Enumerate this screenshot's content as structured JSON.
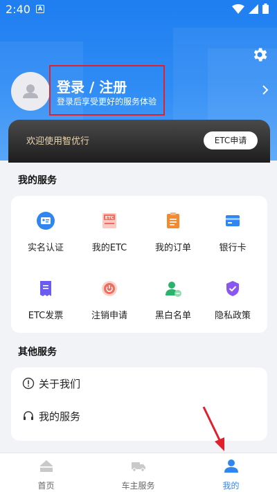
{
  "status_bar": {
    "time": "2:40",
    "notification_letter": "A"
  },
  "profile": {
    "login_title": "登录 / 注册",
    "login_subtitle": "登录后享受更好的服务体验"
  },
  "welcome_banner": {
    "text": "欢迎使用智优行",
    "button_label": "ETC申请"
  },
  "my_services": {
    "title": "我的服务",
    "items": [
      {
        "label": "实名认证",
        "icon": "id-card-icon",
        "color": "#2f86f0"
      },
      {
        "label": "我的ETC",
        "icon": "etc-card-icon",
        "color": "#f36b5a"
      },
      {
        "label": "我的订单",
        "icon": "order-icon",
        "color": "#f58a2a"
      },
      {
        "label": "银行卡",
        "icon": "bank-card-icon",
        "color": "#2f86f0"
      },
      {
        "label": "ETC发票",
        "icon": "invoice-icon",
        "color": "#6a5cf0"
      },
      {
        "label": "注销申请",
        "icon": "power-icon",
        "color": "#f36b5a"
      },
      {
        "label": "黑白名单",
        "icon": "user-list-icon",
        "color": "#2bb36b"
      },
      {
        "label": "隐私政策",
        "icon": "shield-check-icon",
        "color": "#8a56f0"
      }
    ]
  },
  "other_services": {
    "title": "其他服务",
    "items": [
      {
        "label": "关于我们",
        "icon": "info-icon"
      },
      {
        "label": "我的服务",
        "icon": "headset-icon"
      }
    ]
  },
  "tabbar": {
    "tabs": [
      {
        "label": "首页",
        "icon": "home-icon",
        "active": false
      },
      {
        "label": "车主服务",
        "icon": "truck-icon",
        "active": false
      },
      {
        "label": "我的",
        "icon": "user-icon",
        "active": true
      }
    ]
  },
  "colors": {
    "primary": "#2f86f0",
    "annotation_red": "#e0202a",
    "banner_text": "#e8d6b0"
  }
}
